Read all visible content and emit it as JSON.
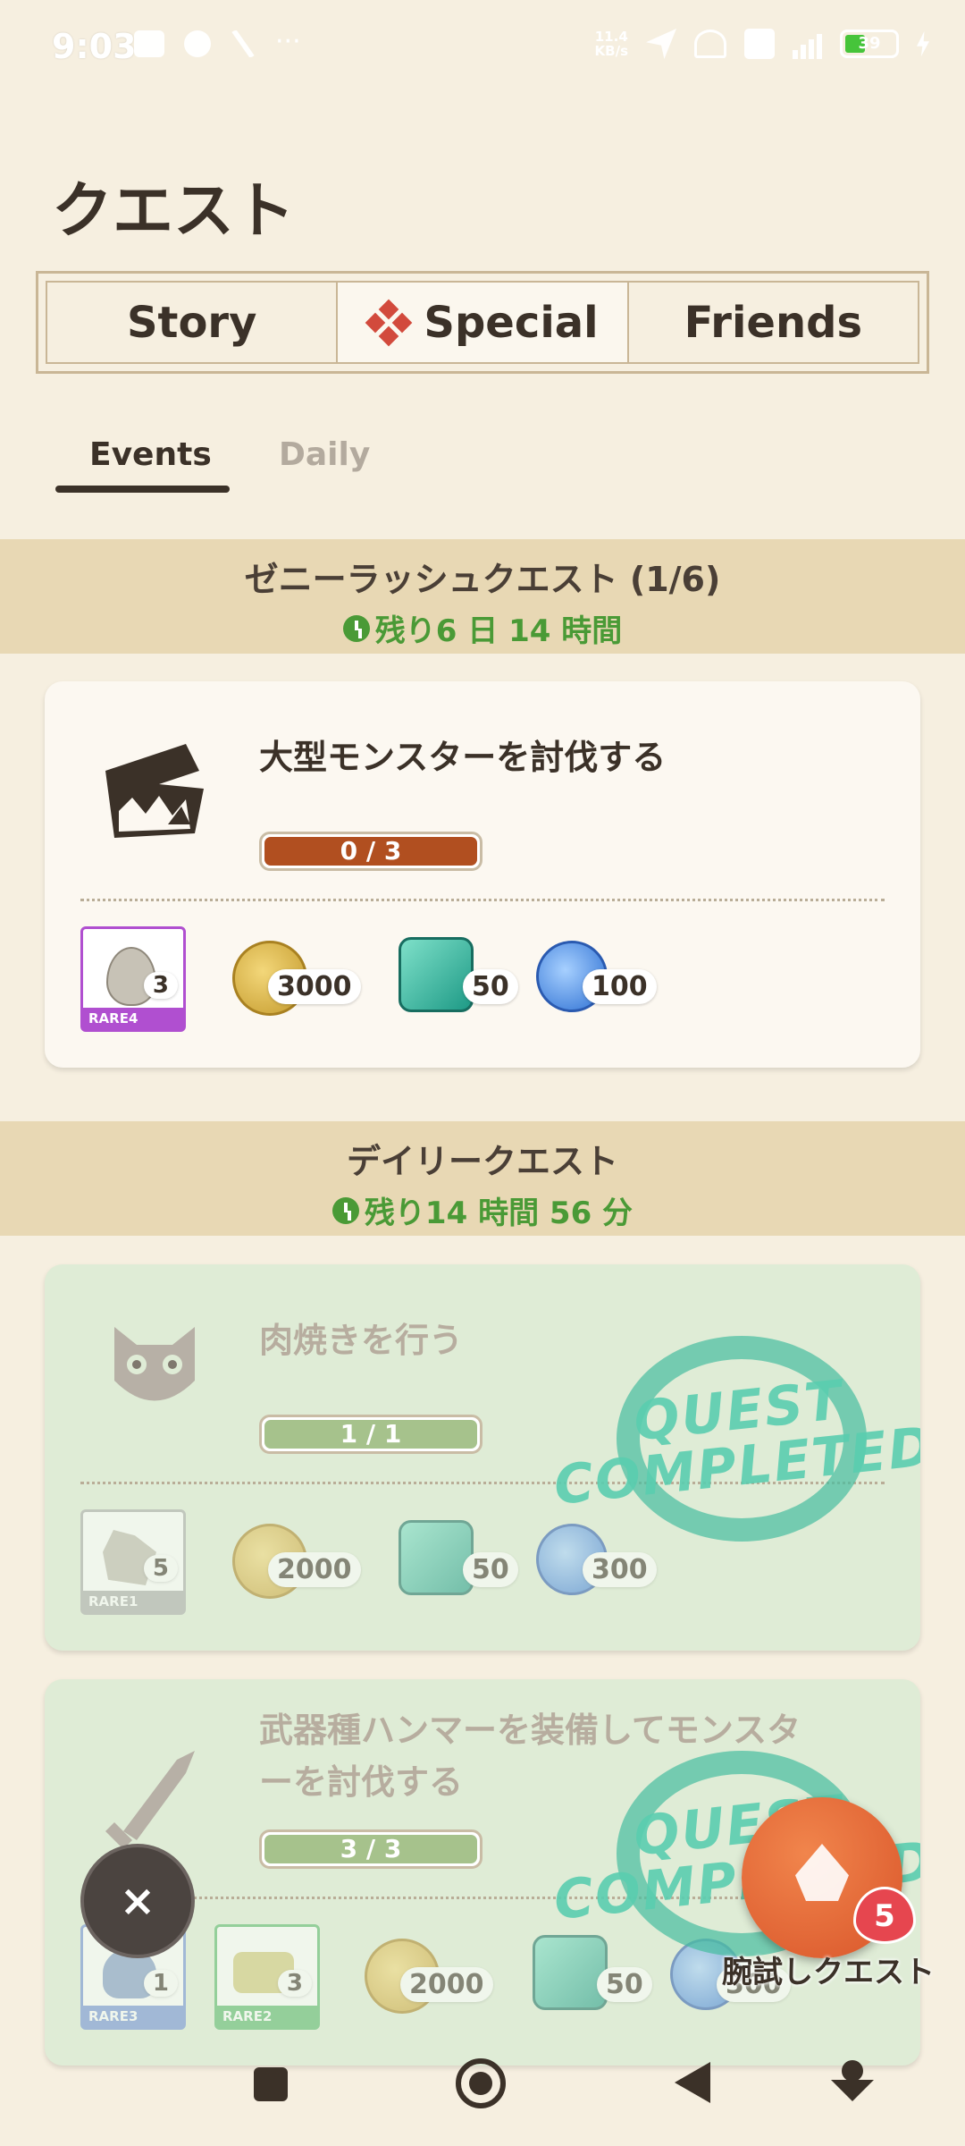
{
  "status_bar": {
    "time": "9:03",
    "net_speed": "11.4\nKB/s",
    "battery": "39"
  },
  "page": {
    "title": "クエスト"
  },
  "segmented_tabs": [
    {
      "label": "Story",
      "active": false
    },
    {
      "label": "Special",
      "active": true
    },
    {
      "label": "Friends",
      "active": false
    }
  ],
  "sub_tabs": [
    {
      "label": "Events",
      "active": true
    },
    {
      "label": "Daily",
      "active": false
    }
  ],
  "sections": {
    "event": {
      "title": "ゼニーラッシュクエスト (1/6)",
      "timer": "残り6 日 14 時間"
    },
    "daily": {
      "title": "デイリークエスト",
      "timer": "残り14 時間 56 分"
    }
  },
  "quests": [
    {
      "title": "大型モンスターを討伐する",
      "progress_text": "0 / 3",
      "progress": 0.0,
      "completed": false,
      "icon": "monster-jaw-icon",
      "rewards": [
        {
          "type": "rare-item",
          "rare": "RARE4",
          "count": "3",
          "color": "#b04fd0"
        },
        {
          "type": "zenny-coin",
          "count": "3000"
        },
        {
          "type": "green-gem",
          "count": "50"
        },
        {
          "type": "blue-orb",
          "count": "100"
        }
      ]
    },
    {
      "title": "肉焼きを行う",
      "progress_text": "1 / 1",
      "progress": 1.0,
      "completed": true,
      "icon": "palico-icon",
      "rewards": [
        {
          "type": "rare-item",
          "rare": "RARE1",
          "count": "5",
          "color": "#a9a9a9"
        },
        {
          "type": "zenny-coin",
          "count": "2000"
        },
        {
          "type": "green-gem",
          "count": "50"
        },
        {
          "type": "blue-orb",
          "count": "300"
        }
      ]
    },
    {
      "title": "武器種ハンマーを装備してモンスターを討伐する",
      "progress_text": "3 / 3",
      "progress": 1.0,
      "completed": true,
      "icon": "hammer-weapon-icon",
      "rewards": [
        {
          "type": "rare-item",
          "rare": "RARE3",
          "count": "1",
          "color": "#6f8fd6"
        },
        {
          "type": "rare-item",
          "rare": "RARE2",
          "count": "3",
          "color": "#58b86a"
        },
        {
          "type": "zenny-coin",
          "count": "2000"
        },
        {
          "type": "green-gem",
          "count": "50"
        },
        {
          "type": "blue-orb",
          "count": "300"
        }
      ]
    }
  ],
  "stamp_text": "QUEST\nCOMPLETED",
  "floating": {
    "close_label": "×",
    "arm_quest_label": "腕試しクエスト",
    "arm_quest_badge": "5"
  },
  "colors": {
    "background": "#f6efe0",
    "section_header": "#e8d8b4",
    "timer_green": "#4a9a36",
    "progress_incomplete": "#b14f20",
    "progress_complete": "#a6c28c"
  }
}
